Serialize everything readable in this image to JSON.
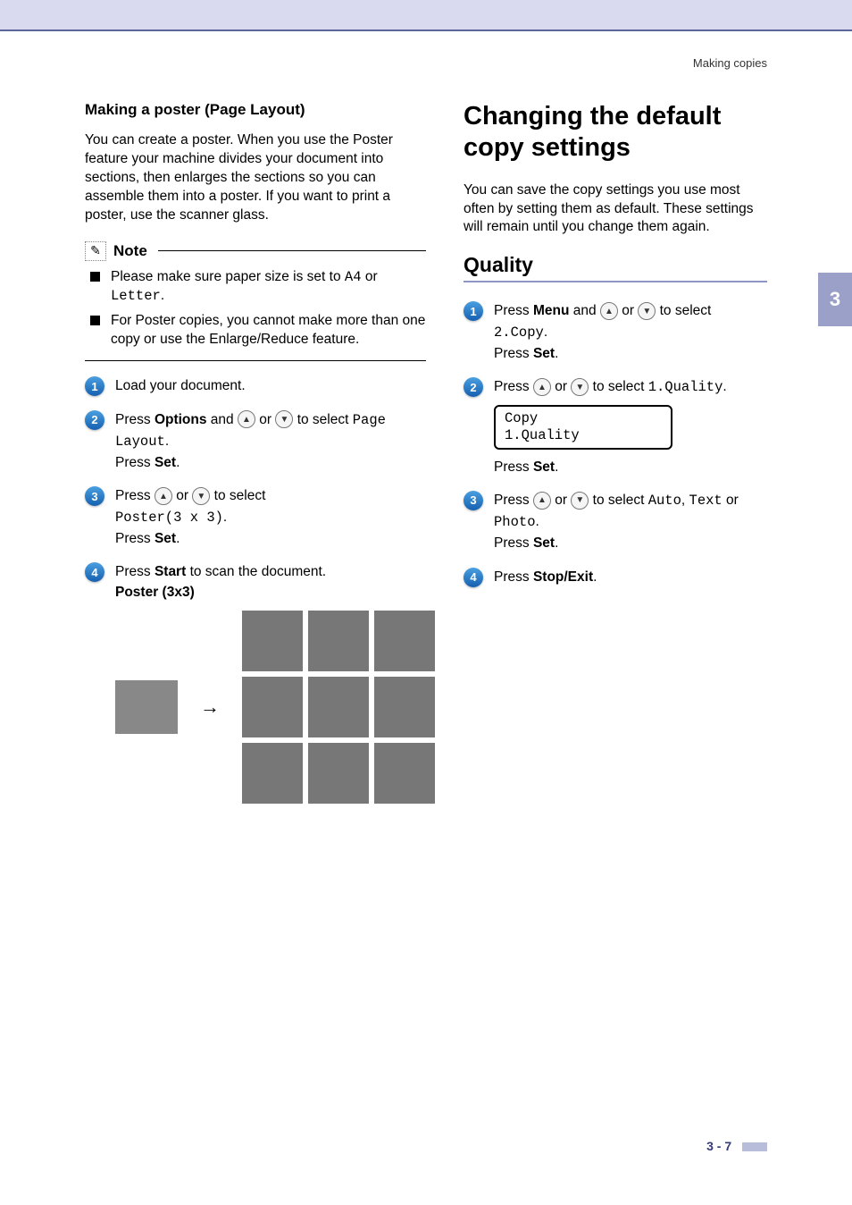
{
  "breadcrumb": "Making copies",
  "tab_number": "3",
  "left": {
    "heading": "Making a poster (Page Layout)",
    "intro": "You can create a poster. When you use the Poster feature your machine divides your document into sections, then enlarges the sections so you can assemble them into a poster. If you want to print a poster, use the scanner glass.",
    "note_label": "Note",
    "note1_a": "Please make sure paper size is set to ",
    "note1_code1": "A4",
    "note1_b": " or ",
    "note1_code2": "Letter",
    "note1_c": ".",
    "note2": "For Poster copies, you cannot make more than one copy or use the Enlarge/Reduce feature.",
    "step1": "Load your document.",
    "step2_a": "Press ",
    "step2_bold": "Options",
    "step2_b": " and ",
    "step2_c": " or ",
    "step2_d": " to select ",
    "step2_code": "Page Layout",
    "step2_e": ".",
    "step2_set_a": "Press ",
    "step2_set_bold": "Set",
    "step2_set_b": ".",
    "step3_a": "Press ",
    "step3_b": " or ",
    "step3_c": " to select ",
    "step3_code": "Poster(3 x 3)",
    "step3_d": ".",
    "step3_set_a": "Press ",
    "step3_set_bold": "Set",
    "step3_set_b": ".",
    "step4_a": "Press ",
    "step4_bold": "Start",
    "step4_b": " to scan the document.",
    "poster_label": "Poster (3x3)"
  },
  "right": {
    "heading": "Changing the default copy settings",
    "intro": "You can save the copy settings you use most often by setting them as default. These settings will remain until you change them again.",
    "sec_heading": "Quality",
    "step1_a": "Press ",
    "step1_bold": "Menu",
    "step1_b": " and ",
    "step1_c": " or ",
    "step1_d": " to select ",
    "step1_code": "2.Copy",
    "step1_e": ".",
    "step1_set_a": "Press ",
    "step1_set_bold": "Set",
    "step1_set_b": ".",
    "step2_a": "Press ",
    "step2_b": " or ",
    "step2_c": " to select ",
    "step2_code": "1.Quality",
    "step2_d": ".",
    "lcd_line1": "Copy",
    "lcd_line2": "1.Quality",
    "step2_set_a": "Press ",
    "step2_set_bold": "Set",
    "step2_set_b": ".",
    "step3_a": "Press ",
    "step3_b": " or ",
    "step3_c": " to select ",
    "step3_code1": "Auto",
    "step3_sep1": ", ",
    "step3_code2": "Text",
    "step3_d": " or ",
    "step3_code3": "Photo",
    "step3_e": ".",
    "step3_set_a": "Press ",
    "step3_set_bold": "Set",
    "step3_set_b": ".",
    "step4_a": "Press ",
    "step4_bold": "Stop/Exit",
    "step4_b": "."
  },
  "page_number": "3 - 7"
}
